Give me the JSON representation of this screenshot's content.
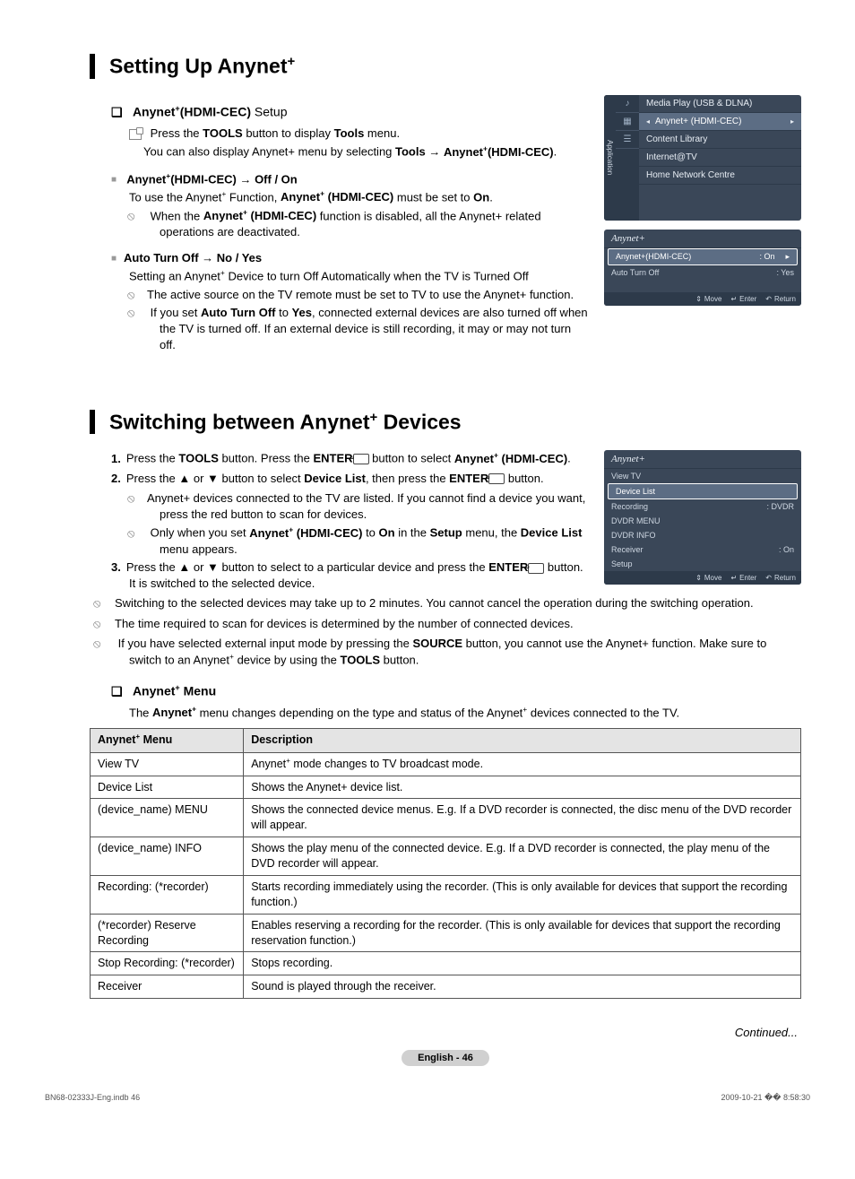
{
  "section1": {
    "title_a": "Setting Up Anynet",
    "title_sup": "+",
    "sub1_a": "Anynet",
    "sub1_b": "(HDMI-CEC)",
    "sub1_c": " Setup",
    "p1a": "Press the ",
    "p1b": "TOOLS",
    "p1c": " button to display ",
    "p1d": "Tools",
    "p1e": " menu.",
    "p2a": "You can also display Anynet+ menu by selecting ",
    "p2b": "Tools",
    "p2c": " → ",
    "p2d": "Anynet",
    "p2e": "(HDMI-CEC)",
    "p2f": ".",
    "bul1_a": "Anynet",
    "bul1_b": "(HDMI-CEC) → Off / On",
    "bul1_line1a": "To use the Anynet",
    "bul1_line1b": " Function, ",
    "bul1_line1c": "Anynet",
    "bul1_line1d": " (HDMI-CEC)",
    "bul1_line1e": " must be set to ",
    "bul1_line1f": "On",
    "bul1_line1g": ".",
    "bul1_note_a": "When the ",
    "bul1_note_b": "Anynet",
    "bul1_note_c": " (HDMI-CEC)",
    "bul1_note_d": " function is disabled, all the Anynet+ related operations are deactivated.",
    "bul2": "Auto Turn Off → No / Yes",
    "bul2_line1a": "Setting an Anynet",
    "bul2_line1b": " Device to turn Off Automatically when the TV is Turned Off",
    "bul2_note1": "The active source on the TV remote must be set to TV to use the Anynet+ function.",
    "bul2_note2a": "If you set ",
    "bul2_note2b": "Auto Turn Off",
    "bul2_note2c": " to ",
    "bul2_note2d": "Yes",
    "bul2_note2e": ", connected external devices are also turned off when the TV is turned off. If an external device is still recording, it may or may not turn off."
  },
  "osd_app": {
    "side": "Application",
    "items": [
      "Media Play (USB & DLNA)",
      "Anynet+ (HDMI-CEC)",
      "Content Library",
      "Internet@TV",
      "Home Network Centre"
    ]
  },
  "osd_setup": {
    "title": "Anynet+",
    "rows": [
      {
        "k": "Anynet+(HDMI-CEC)",
        "v": ": On"
      },
      {
        "k": "Auto Turn Off",
        "v": ": Yes"
      }
    ],
    "footer": [
      "Move",
      "Enter",
      "Return"
    ]
  },
  "section2": {
    "title_a": "Switching between Anynet",
    "title_b": " Devices",
    "step1a": "Press the ",
    "step1b": "TOOLS",
    "step1c": " button. Press the ",
    "step1d": "ENTER",
    "step1e": " button to select ",
    "step1f": "Anynet",
    "step1g": " (HDMI-CEC)",
    "step1h": ".",
    "step2a": "Press the ▲ or ▼ button to select ",
    "step2b": "Device List",
    "step2c": ", then press the ",
    "step2d": "ENTER",
    "step2e": " button.",
    "step2_n1": "Anynet+ devices connected to the TV are listed. If you cannot find a device you want, press the red button to scan for devices.",
    "step2_n2a": "Only when you set ",
    "step2_n2b": "Anynet",
    "step2_n2c": " (HDMI-CEC)",
    "step2_n2d": " to ",
    "step2_n2e": "On",
    "step2_n2f": " in the ",
    "step2_n2g": "Setup",
    "step2_n2h": " menu, the ",
    "step2_n2i": "Device List",
    "step2_n2j": " menu appears.",
    "step3a": "Press the ▲ or ▼ button to select to a particular device and press the ",
    "step3b": "ENTER",
    "step3c": " button. It is switched to the selected device.",
    "g_note1": "Switching to the selected devices may take up to 2 minutes. You cannot cancel the operation during the switching operation.",
    "g_note2": "The time required to scan for devices is determined by the number of connected devices.",
    "g_note3a": "If you have selected external input mode by pressing the ",
    "g_note3b": "SOURCE",
    "g_note3c": " button, you cannot use the Anynet+ function. Make sure to switch to an Anynet",
    "g_note3d": " device by using the ",
    "g_note3e": "TOOLS",
    "g_note3f": " button."
  },
  "osd_dev": {
    "title": "Anynet+",
    "rows": [
      {
        "k": "View TV",
        "v": ""
      },
      {
        "k": "Device List",
        "v": ""
      },
      {
        "k": "Recording",
        "v": ": DVDR"
      },
      {
        "k": "DVDR MENU",
        "v": ""
      },
      {
        "k": "DVDR INFO",
        "v": ""
      },
      {
        "k": "Receiver",
        "v": ": On"
      },
      {
        "k": "Setup",
        "v": ""
      }
    ],
    "footer": [
      "Move",
      "Enter",
      "Return"
    ]
  },
  "menu_section": {
    "title_a": "Anynet",
    "title_b": " Menu",
    "intro_a": "The ",
    "intro_b": "Anynet",
    "intro_c": " menu changes depending on the type and status of the Anynet",
    "intro_d": " devices connected to the TV."
  },
  "table": {
    "h1": "Anynet+ Menu",
    "h1_a": "Anynet",
    "h1_b": " Menu",
    "h2": "Description",
    "rows": [
      {
        "m": "View TV",
        "d_a": "Anynet",
        "d_b": " mode changes to TV broadcast mode."
      },
      {
        "m": "Device List",
        "d": "Shows the Anynet+ device list."
      },
      {
        "m": "(device_name) MENU",
        "d": "Shows the connected device menus. E.g. If a DVD recorder is connected, the disc menu of the DVD recorder will appear."
      },
      {
        "m": "(device_name) INFO",
        "d": "Shows the play menu of the connected device. E.g. If a DVD recorder is connected, the play menu of the DVD recorder will appear."
      },
      {
        "m": "Recording: (*recorder)",
        "d": "Starts recording immediately using the recorder. (This is only available for devices that support the recording function.)"
      },
      {
        "m": "(*recorder) Reserve Recording",
        "d": "Enables reserving a recording for the recorder. (This is only available for devices that support the recording reservation function.)"
      },
      {
        "m": "Stop Recording: (*recorder)",
        "d": "Stops recording."
      },
      {
        "m": "Receiver",
        "d": "Sound is played through the receiver."
      }
    ]
  },
  "continued": "Continued...",
  "page_label": "English - 46",
  "meta": {
    "left": "BN68-02333J-Eng.indb   46",
    "right": "2009-10-21   �� 8:58:30"
  }
}
